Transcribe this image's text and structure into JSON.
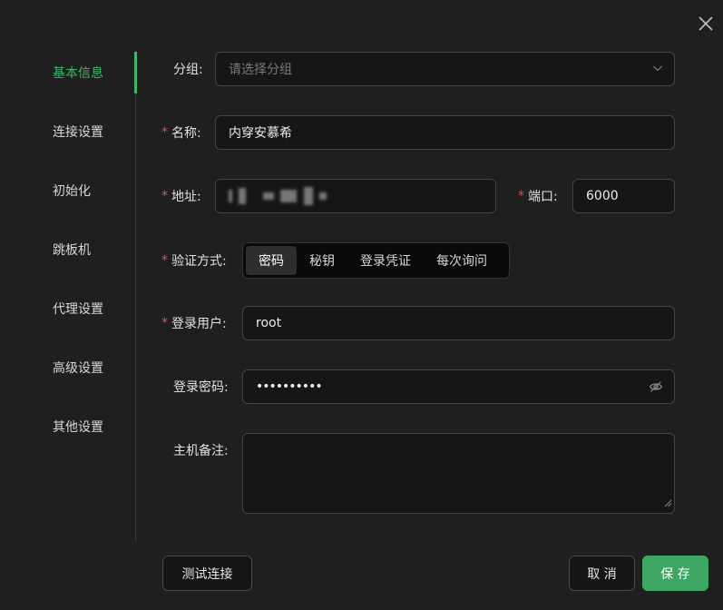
{
  "sidebar": {
    "items": [
      {
        "label": "基本信息",
        "active": true
      },
      {
        "label": "连接设置"
      },
      {
        "label": "初始化"
      },
      {
        "label": "跳板机"
      },
      {
        "label": "代理设置"
      },
      {
        "label": "高级设置"
      },
      {
        "label": "其他设置"
      }
    ]
  },
  "form": {
    "group": {
      "label": "分组:",
      "placeholder": "请选择分组"
    },
    "name": {
      "label": "名称:",
      "value": "内穿安慕希"
    },
    "address": {
      "label": "地址:"
    },
    "port": {
      "label": "端口:",
      "value": "6000"
    },
    "auth": {
      "label": "验证方式:",
      "options": [
        "密码",
        "秘钥",
        "登录凭证",
        "每次询问"
      ],
      "selected": "密码"
    },
    "user": {
      "label": "登录用户:",
      "value": "root"
    },
    "password": {
      "label": "登录密码:",
      "value": "••••••••••"
    },
    "remark": {
      "label": "主机备注:"
    }
  },
  "footer": {
    "test_label": "测试连接",
    "cancel_label": "取 消",
    "save_label": "保 存"
  },
  "colors": {
    "accent": "#3fb56a",
    "required": "#e0524d",
    "primary_button": "#3fa565"
  },
  "icons": {
    "close": "close-icon",
    "chevron": "chevron-down-icon",
    "eye": "eye-off-icon"
  }
}
